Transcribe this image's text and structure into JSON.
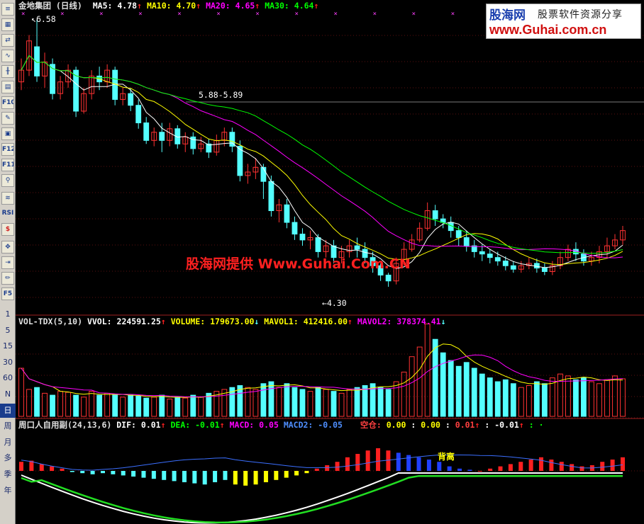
{
  "toolbar": {
    "icons": [
      "list-icon",
      "grid-icon",
      "compare-icon",
      "line-chart-icon",
      "kline-icon",
      "report-icon",
      "f10-icon",
      "notes-icon",
      "calendar-icon",
      "f12-icon",
      "f11-icon",
      "search-icon",
      "overlay-icon",
      "rsi-icon",
      "money-icon",
      "move-icon",
      "exit-icon",
      "pencil-icon",
      "f5-icon"
    ],
    "labels": {
      "rsi": "RSI",
      "f10": "F10",
      "f12": "F12",
      "f11": "F11",
      "f5": "F5"
    },
    "periods": [
      "1",
      "5",
      "15",
      "30",
      "60",
      "N",
      "日",
      "周",
      "月",
      "多",
      "季",
      "年"
    ]
  },
  "price_panel": {
    "stock_name": "金地集团 (日线)",
    "ma5_label": "MA5:",
    "ma5_value": "4.78",
    "ma10_label": "MA10:",
    "ma10_value": "4.70",
    "ma20_label": "MA20:",
    "ma20_value": "4.65",
    "ma30_label": "MA30:",
    "ma30_value": "4.64",
    "high_marker": "6.58",
    "range_marker": "5.88-5.89",
    "low_marker": "4.30",
    "colors": {
      "ma5": "#ffffff",
      "ma10": "#ffff00",
      "ma20": "#ff00ff",
      "ma30": "#00ff00",
      "up": "#ff3232",
      "down": "#54ffff",
      "arrow": "#ff2020"
    }
  },
  "volume_panel": {
    "indicator": "VOL-TDX(5,10)",
    "vvol_label": "VVOL:",
    "vvol_value": "224591.25",
    "volume_label": "VOLUME:",
    "volume_value": "179673.00",
    "mavol1_label": "MAVOL1:",
    "mavol1_value": "412416.00",
    "mavol2_label": "MAVOL2:",
    "mavol2_value": "378374.41"
  },
  "macd_panel": {
    "indicator": "周口人自用副(24,13,6)",
    "dif_label": "DIF:",
    "dif_value": "0.01",
    "dea_label": "DEA:",
    "dea_value": "-0.01",
    "macd_label": "MACD:",
    "macd_value": "0.05",
    "macd2_label": "MACD2:",
    "macd2_value": "-0.05",
    "kongcang_label": "空仓:",
    "kongcang_value": "0.00",
    "v1": "0.00",
    "v2": "0.01",
    "v3": "-0.01",
    "divergence_label": "背离"
  },
  "logo": {
    "brand": "股海网",
    "tagline": "股票软件资源分享",
    "url": "www.Guhai.com.cn"
  },
  "watermark": "股海网提供 Www.Guhai.Com.CN",
  "chart_data": {
    "type": "candlestick",
    "price_range": [
      4.3,
      6.58
    ],
    "candles": [
      [
        6.05,
        6.15,
        6.25,
        5.98
      ],
      [
        6.15,
        6.4,
        6.45,
        6.1
      ],
      [
        6.35,
        6.1,
        6.58,
        6.05
      ],
      [
        6.1,
        6.22,
        6.3,
        6.0
      ],
      [
        6.2,
        5.95,
        6.25,
        5.9
      ],
      [
        5.95,
        6.05,
        6.1,
        5.9
      ],
      [
        6.05,
        6.15,
        6.2,
        6.0
      ],
      [
        6.15,
        5.8,
        6.18,
        5.75
      ],
      [
        5.8,
        5.95,
        6.0,
        5.78
      ],
      [
        5.95,
        6.1,
        6.15,
        5.9
      ],
      [
        6.1,
        6.05,
        6.18,
        5.98
      ],
      [
        6.05,
        6.15,
        6.2,
        6.0
      ],
      [
        6.15,
        5.9,
        6.18,
        5.85
      ],
      [
        5.9,
        5.95,
        6.0,
        5.85
      ],
      [
        5.95,
        5.85,
        6.0,
        5.8
      ],
      [
        5.85,
        5.7,
        5.9,
        5.65
      ],
      [
        5.7,
        5.55,
        5.75,
        5.52
      ],
      [
        5.55,
        5.62,
        5.66,
        5.5
      ],
      [
        5.62,
        5.55,
        5.7,
        5.45
      ],
      [
        5.55,
        5.65,
        5.7,
        5.5
      ],
      [
        5.65,
        5.52,
        5.68,
        5.48
      ],
      [
        5.52,
        5.58,
        5.62,
        5.45
      ],
      [
        5.58,
        5.48,
        5.62,
        5.43
      ],
      [
        5.48,
        5.52,
        5.58,
        5.45
      ],
      [
        5.52,
        5.45,
        5.56,
        5.4
      ],
      [
        5.45,
        5.55,
        5.6,
        5.42
      ],
      [
        5.55,
        5.62,
        5.66,
        5.5
      ],
      [
        5.62,
        5.5,
        5.66,
        5.45
      ],
      [
        5.5,
        5.25,
        5.55,
        5.2
      ],
      [
        5.25,
        5.28,
        5.35,
        5.18
      ],
      [
        5.28,
        5.32,
        5.4,
        5.22
      ],
      [
        5.32,
        5.2,
        5.35,
        5.05
      ],
      [
        5.2,
        4.95,
        5.25,
        4.9
      ],
      [
        4.95,
        5.0,
        5.05,
        4.85
      ],
      [
        5.0,
        4.85,
        5.05,
        4.8
      ],
      [
        4.85,
        4.75,
        4.9,
        4.7
      ],
      [
        4.75,
        4.7,
        4.8,
        4.65
      ],
      [
        4.7,
        4.72,
        4.78,
        4.62
      ],
      [
        4.72,
        4.6,
        4.75,
        4.55
      ],
      [
        4.6,
        4.65,
        4.7,
        4.55
      ],
      [
        4.65,
        4.55,
        4.7,
        4.5
      ],
      [
        4.55,
        4.6,
        4.65,
        4.5
      ],
      [
        4.6,
        4.65,
        4.7,
        4.55
      ],
      [
        4.65,
        4.62,
        4.72,
        4.55
      ],
      [
        4.62,
        4.55,
        4.68,
        4.5
      ],
      [
        4.55,
        4.48,
        4.6,
        4.42
      ],
      [
        4.48,
        4.4,
        4.5,
        4.35
      ],
      [
        4.4,
        4.35,
        4.42,
        4.3
      ],
      [
        4.35,
        4.5,
        4.55,
        4.32
      ],
      [
        4.5,
        4.62,
        4.68,
        4.48
      ],
      [
        4.62,
        4.7,
        4.75,
        4.6
      ],
      [
        4.7,
        4.8,
        4.85,
        4.68
      ],
      [
        4.8,
        4.95,
        5.02,
        4.78
      ],
      [
        4.95,
        4.88,
        5.0,
        4.82
      ],
      [
        4.88,
        4.85,
        4.92,
        4.8
      ],
      [
        4.85,
        4.78,
        4.9,
        4.72
      ],
      [
        4.78,
        4.72,
        4.82,
        4.65
      ],
      [
        4.72,
        4.65,
        4.78,
        4.6
      ],
      [
        4.65,
        4.6,
        4.7,
        4.55
      ],
      [
        4.6,
        4.58,
        4.66,
        4.52
      ],
      [
        4.58,
        4.55,
        4.62,
        4.5
      ],
      [
        4.55,
        4.52,
        4.6,
        4.48
      ],
      [
        4.52,
        4.48,
        4.56,
        4.44
      ],
      [
        4.48,
        4.45,
        4.52,
        4.42
      ],
      [
        4.45,
        4.48,
        4.52,
        4.42
      ],
      [
        4.48,
        4.5,
        4.55,
        4.45
      ],
      [
        4.5,
        4.46,
        4.54,
        4.42
      ],
      [
        4.46,
        4.43,
        4.5,
        4.4
      ],
      [
        4.43,
        4.48,
        4.52,
        4.4
      ],
      [
        4.48,
        4.55,
        4.6,
        4.45
      ],
      [
        4.55,
        4.62,
        4.66,
        4.52
      ],
      [
        4.62,
        4.58,
        4.68,
        4.52
      ],
      [
        4.58,
        4.52,
        4.62,
        4.48
      ],
      [
        4.52,
        4.55,
        4.6,
        4.48
      ],
      [
        4.55,
        4.6,
        4.65,
        4.5
      ],
      [
        4.6,
        4.65,
        4.72,
        4.55
      ],
      [
        4.65,
        4.7,
        4.75,
        4.62
      ],
      [
        4.7,
        4.78,
        4.82,
        4.66
      ]
    ],
    "volume": [
      0.5,
      0.28,
      0.3,
      0.24,
      0.22,
      0.26,
      0.25,
      0.22,
      0.2,
      0.26,
      0.22,
      0.24,
      0.22,
      0.2,
      0.22,
      0.21,
      0.19,
      0.2,
      0.22,
      0.18,
      0.2,
      0.19,
      0.22,
      0.2,
      0.24,
      0.26,
      0.28,
      0.3,
      0.32,
      0.3,
      0.28,
      0.34,
      0.36,
      0.3,
      0.34,
      0.3,
      0.28,
      0.26,
      0.3,
      0.28,
      0.26,
      0.24,
      0.28,
      0.3,
      0.32,
      0.34,
      0.3,
      0.28,
      0.36,
      0.46,
      0.62,
      0.72,
      0.96,
      0.8,
      0.66,
      0.58,
      0.52,
      0.56,
      0.5,
      0.44,
      0.4,
      0.36,
      0.38,
      0.34,
      0.3,
      0.32,
      0.36,
      0.34,
      0.4,
      0.44,
      0.42,
      0.38,
      0.4,
      0.36,
      0.34,
      0.38,
      0.42,
      0.39
    ],
    "macd_bars": [
      0.08,
      0.09,
      0.06,
      0.04,
      0.02,
      -0.01,
      -0.02,
      -0.03,
      -0.02,
      -0.03,
      -0.04,
      -0.05,
      -0.06,
      -0.07,
      -0.08,
      -0.09,
      -0.1,
      -0.11,
      -0.12,
      -0.1,
      -0.08,
      -0.12,
      -0.13,
      -0.12,
      -0.1,
      -0.08,
      -0.06,
      -0.04,
      -0.02,
      0.02,
      0.05,
      0.08,
      0.12,
      0.15,
      0.18,
      0.2,
      0.18,
      0.16,
      0.14,
      0.12,
      0.1,
      0.08,
      0.04,
      0.02,
      0.01,
      0.0,
      0.02,
      0.04,
      0.06,
      0.08,
      0.1,
      0.12,
      0.1,
      0.08,
      0.06,
      0.04,
      0.05,
      0.08,
      0.1,
      0.12
    ]
  }
}
